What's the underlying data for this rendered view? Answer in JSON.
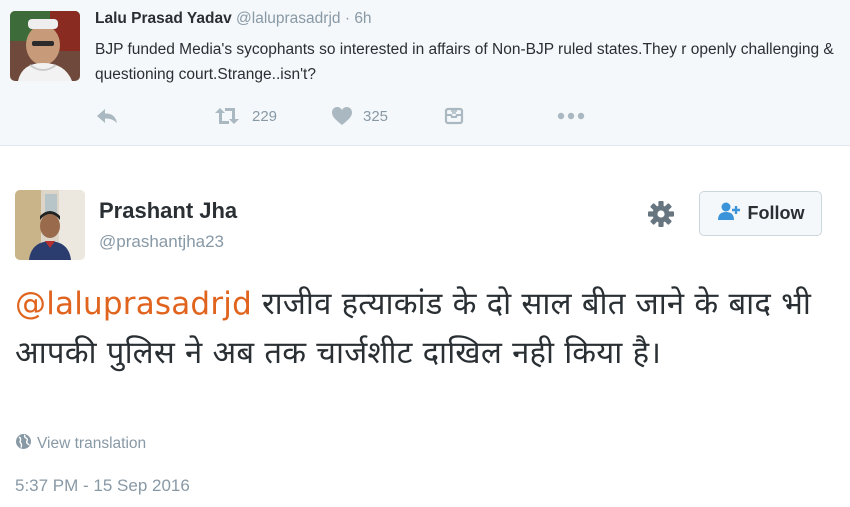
{
  "parent_tweet": {
    "author_name": "Lalu Prasad Yadav",
    "author_handle": "@laluprasadrjd",
    "separator": "·",
    "time": "6h",
    "text": "BJP funded Media's sycophants so interested in affairs of Non-BJP ruled states.They r openly challenging & questioning court.Strange..isn't?",
    "actions": {
      "retweet_count": "229",
      "like_count": "325"
    }
  },
  "main_tweet": {
    "author_name": "Prashant Jha",
    "author_handle": "@prashantjha23",
    "follow_label": "Follow",
    "mention": "@laluprasadrjd",
    "text": " राजीव हत्याकांड के दो साल बीत जाने के बाद भी आपकी पुलिस ने अब तक चार्जशीट दाखिल नही किया है।",
    "translate_label": "View translation",
    "timestamp": "5:37 PM - 15 Sep 2016"
  },
  "colors": {
    "mention": "#e0641e",
    "muted": "#8899a6",
    "text": "#292f33",
    "parent_background": "#f5f8fa"
  },
  "icons": [
    "reply-icon",
    "retweet-icon",
    "heart-icon",
    "dm-icon",
    "more-icon",
    "gear-icon",
    "add-user-icon",
    "globe-icon"
  ]
}
